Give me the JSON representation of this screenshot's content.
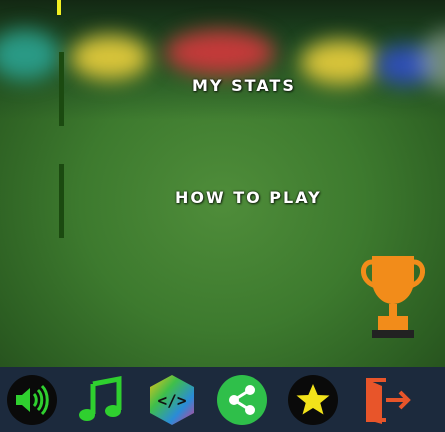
{
  "menu": {
    "my_stats_label": "MY STATS",
    "how_to_play_label": "HOW TO PLAY"
  },
  "colors": {
    "accent_yellow": "#f2ef22",
    "toolbar_bg": "#1c2a3d",
    "trophy_orange": "#f28c1a",
    "green_icon": "#2fd02f",
    "share_green": "#2fbf4a",
    "exit_orange": "#e8552a"
  },
  "toolbar": {
    "icons": [
      "sound-icon",
      "music-icon",
      "code-icon",
      "share-icon",
      "star-icon",
      "exit-icon"
    ]
  }
}
